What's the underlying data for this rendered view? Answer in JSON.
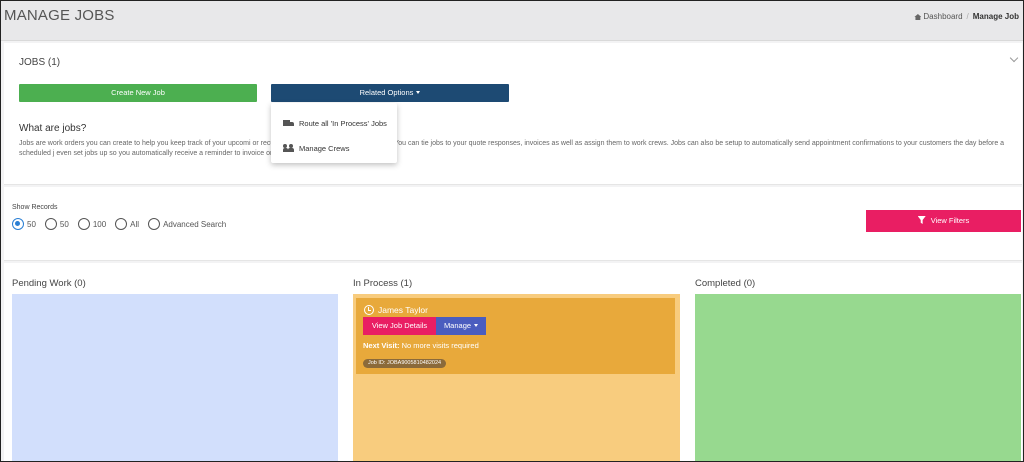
{
  "header": {
    "title": "MANAGE JOBS",
    "breadcrumb": {
      "home": "Dashboard",
      "current": "Manage Job"
    }
  },
  "jobs": {
    "heading": "JOBS (1)",
    "create_label": "Create New Job",
    "related_label": "Related Options",
    "what_heading": "What are jobs?",
    "what_text": "Jobs are work orders you can create to help you keep track of your upcomi                                                          or recurring jobs based off a number of visits. You can tie jobs to your quote responses, invoices as well as assign them to work crews. Jobs can also be setup to automatically send appointment confirmations to your customers the day before a scheduled j                                                          even set jobs up so you automatically receive a reminder to invoice once the job has been completed."
  },
  "dropdown": {
    "items": [
      {
        "label": "Route all 'In Process' Jobs",
        "icon": "truck-icon"
      },
      {
        "label": "Manage Crews",
        "icon": "users-icon"
      }
    ]
  },
  "records": {
    "label": "Show Records",
    "options": [
      "50",
      "50",
      "100",
      "All",
      "Advanced Search"
    ],
    "selected_index": 0,
    "filters_label": "View Filters"
  },
  "board": {
    "columns": [
      {
        "title": "Pending Work (0)",
        "color": "#d2dffc"
      },
      {
        "title": "In Process (1)",
        "color": "#f8cc7e"
      },
      {
        "title": "Completed (0)",
        "color": "#97d98f"
      }
    ],
    "job": {
      "name": "James Taylor",
      "view_label": "View Job Details",
      "manage_label": "Manage",
      "next_visit_label": "Next Visit:",
      "next_visit_value": "No more visits required",
      "job_id": "Job ID: JOBA9005810482024"
    }
  },
  "colors": {
    "create": "#4caf50",
    "related": "#1d4a73",
    "filters": "#e91e63",
    "card": "#e8a93b",
    "manage": "#4a5dbf"
  }
}
